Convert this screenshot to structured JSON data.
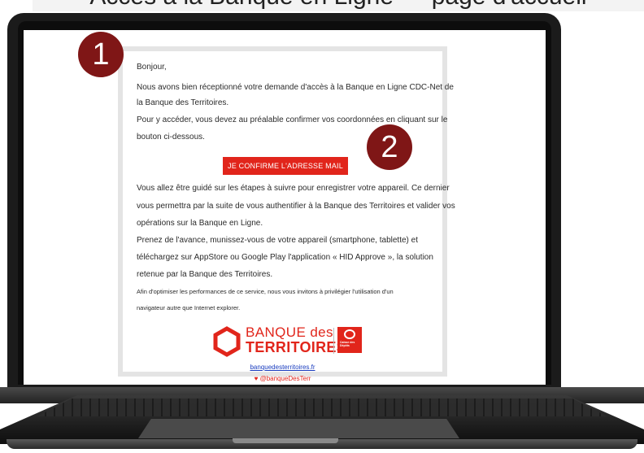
{
  "caption": "Accès à la Banque en Ligne — page d'accueil",
  "email": {
    "greeting": "Bonjour,",
    "para1_line1": "Nous avons bien réceptionné votre demande d'accès à la Banque en Ligne CDC-Net de",
    "para1_line2": "la Banque des Territoires.",
    "para2_line1": "Pour y accéder, vous devez au préalable confirmer vos coordonnées en cliquant sur le",
    "para2_line2": "bouton ci-dessous.",
    "cta_label": "JE CONFIRME L'ADRESSE MAIL",
    "para3_line1": "Vous allez être guidé sur les étapes à suivre pour enregistrer votre appareil. Ce dernier",
    "para3_line2": "vous permettra par la suite de vous authentifier à la Banque des Territoires et valider vos",
    "para3_line3": "opérations sur la Banque en Ligne.",
    "para4_line1": "Prenez de l'avance, munissez-vous de votre appareil (smartphone, tablette) et",
    "para4_line2": "téléchargez sur AppStore ou Google Play l'application « HID Approve », la solution",
    "para4_line3": "retenue par la Banque des Territoires.",
    "note_line1": "Afin d'optimiser les performances de ce service, nous vous invitons à privilégier l'utilisation d'un",
    "note_line2": "navigateur autre que Internet explorer.",
    "logo_line1": "BANQUE des",
    "logo_line2": "TERRITOIRES",
    "cdc_text": "Caisse des Dépôts",
    "website_link": "banquedesterritoires.fr",
    "social_handle": "@banqueDesTerr"
  },
  "badges": [
    "1",
    "2"
  ],
  "colors": {
    "brand_red": "#e1251b",
    "badge": "#7f1616",
    "link": "#1a3dbf"
  }
}
